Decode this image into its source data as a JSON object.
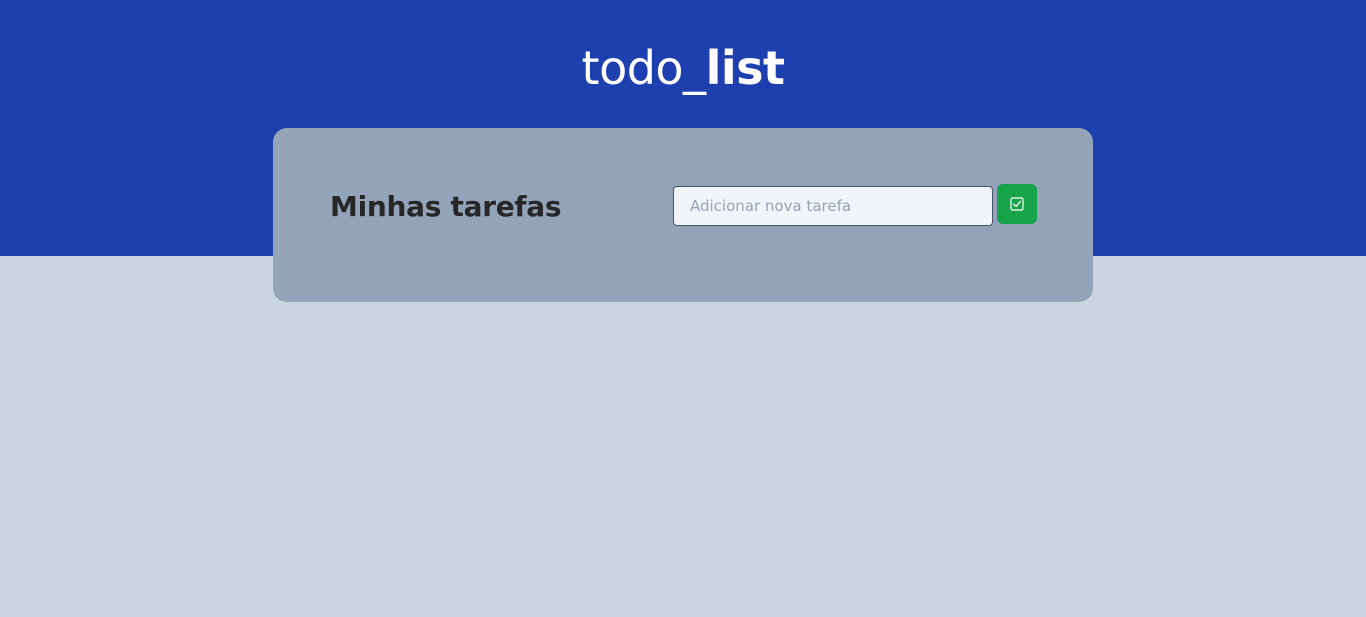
{
  "header": {
    "title_regular": "todo_",
    "title_bold": "list",
    "background_color": "#1e40af"
  },
  "page": {
    "background_color": "#cbd5e1"
  },
  "card": {
    "heading": "Minhas tarefas",
    "background_color": "#94a3b8",
    "input": {
      "value": "",
      "placeholder": "Adicionar nova tarefa"
    },
    "add_button": {
      "icon": "square-check-icon",
      "color": "#16a34a"
    }
  }
}
